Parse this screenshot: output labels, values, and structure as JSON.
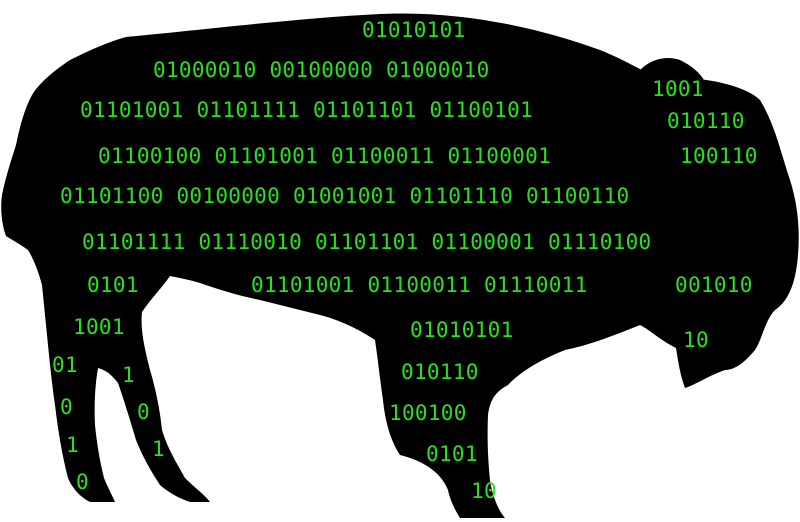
{
  "colors": {
    "silhouette": "#000000",
    "binary_text": "#29e01f",
    "background": "#ffffff"
  },
  "figure": {
    "subject": "bison-silhouette-icon",
    "lines": [
      "01010101",
      "01000010 00100000 01000010",
      "1001",
      "01101001 01101111 01101101 01100101",
      "010110",
      "01100100 01101001 01100011 01100001",
      "100110",
      "01101100 00100000 01001001 01101110 01100110",
      "01101111 01110010 01101101 01100001 01110100",
      "0101",
      "01101001 01100011 01110011",
      "001010",
      "1001",
      "01010101",
      "10",
      "01",
      "1",
      "010110",
      "0",
      "0",
      "100100",
      "1",
      "1",
      "0101",
      "0",
      "10"
    ]
  }
}
